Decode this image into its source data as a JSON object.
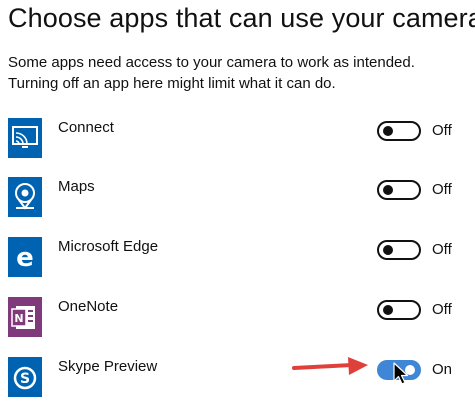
{
  "page": {
    "title": "Choose apps that can use your camera",
    "description_line1": "Some apps need access to your camera to work as intended.",
    "description_line2": "Turning off an app here might limit what it can do."
  },
  "apps": [
    {
      "name": "Connect",
      "state": "Off",
      "enabled": false,
      "icon": "connect-icon",
      "icon_color": "#0063b1"
    },
    {
      "name": "Maps",
      "state": "Off",
      "enabled": false,
      "icon": "maps-icon",
      "icon_color": "#0063b1"
    },
    {
      "name": "Microsoft Edge",
      "state": "Off",
      "enabled": false,
      "icon": "edge-icon",
      "icon_color": "#0063b1"
    },
    {
      "name": "OneNote",
      "state": "Off",
      "enabled": false,
      "icon": "onenote-icon",
      "icon_color": "#80397b"
    },
    {
      "name": "Skype Preview",
      "state": "On",
      "enabled": true,
      "icon": "skype-icon",
      "icon_color": "#0063b1"
    }
  ],
  "colors": {
    "toggle_on": "#3f87d6",
    "annotation_arrow": "#e0403a"
  }
}
